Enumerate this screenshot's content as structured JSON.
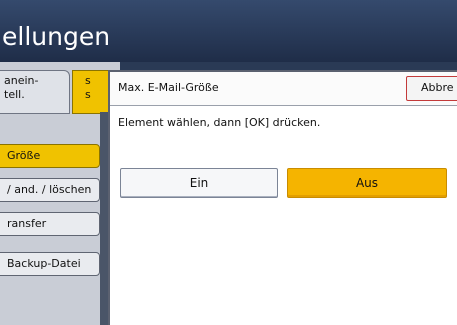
{
  "header": {
    "title": "ellungen"
  },
  "tabs": [
    {
      "label": "anein-\ntell."
    },
    {
      "label": "s\ns"
    }
  ],
  "menu": {
    "items": [
      {
        "label": "Größe",
        "active": true
      },
      {
        "label": "/ and. / löschen",
        "active": false
      },
      {
        "label": "ransfer",
        "active": false
      },
      {
        "label": "Backup-Datei",
        "active": false
      }
    ]
  },
  "dialog": {
    "title": "Max. E-Mail-Größe",
    "cancel_label": "Abbre",
    "instruction": "Element wählen, dann [OK] drücken.",
    "options": [
      {
        "label": "Ein",
        "selected": false
      },
      {
        "label": "Aus",
        "selected": true
      }
    ]
  },
  "colors": {
    "accent": "#f5b400",
    "titlebar": "#2a3a55"
  }
}
